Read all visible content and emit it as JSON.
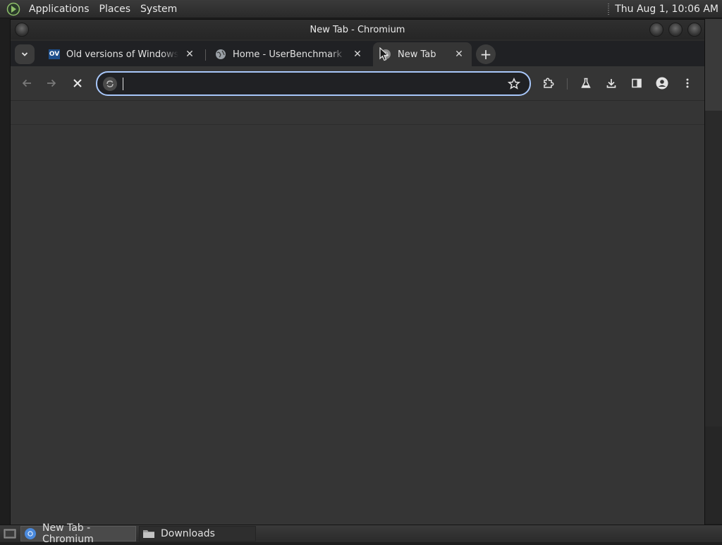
{
  "top_panel": {
    "menus": [
      "Applications",
      "Places",
      "System"
    ],
    "clock": "Thu Aug  1, 10:06 AM"
  },
  "window": {
    "title": "New Tab - Chromium"
  },
  "tabs": [
    {
      "title": "Old versions of Windows, Mac",
      "favicon": "ov-favicon",
      "active": false
    },
    {
      "title": "Home - UserBenchmark",
      "favicon": "globe-icon",
      "active": false
    },
    {
      "title": "New Tab",
      "favicon": "chromium-icon",
      "active": true
    }
  ],
  "toolbar": {
    "omnibox_value": "",
    "omnibox_placeholder": ""
  },
  "taskbar": {
    "items": [
      {
        "label": "New Tab - Chromium",
        "icon": "chromium-icon",
        "active": true
      },
      {
        "label": "Downloads",
        "icon": "folder-icon",
        "active": false
      }
    ]
  },
  "colors": {
    "accent": "#a8c7fa",
    "toolbar_bg": "#353535",
    "tabstrip_bg": "#202124"
  }
}
